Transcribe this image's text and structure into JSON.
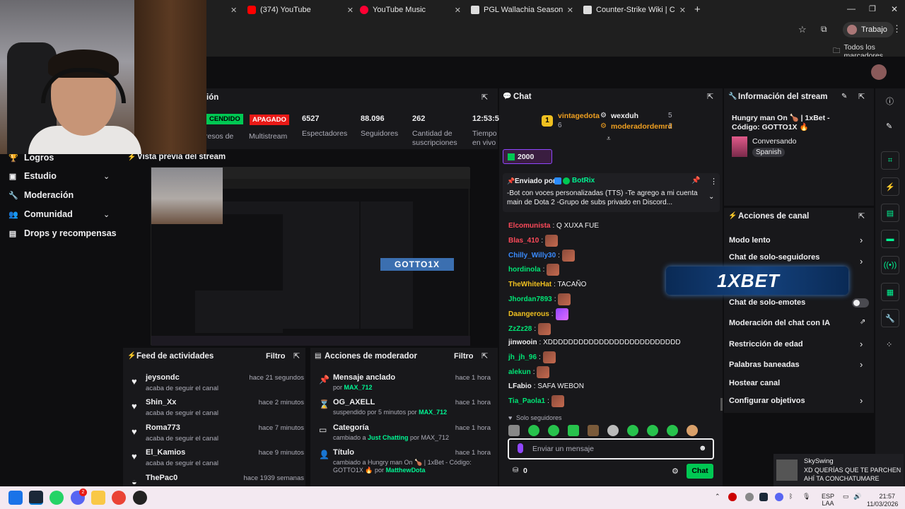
{
  "browser": {
    "tabs": [
      {
        "label": "(374) YouTube",
        "color": "#ff0000"
      },
      {
        "label": "YouTube Music",
        "color": "#ff0033"
      },
      {
        "label": "PGL Wallachia Season 7 - Liqui",
        "color": "#ffffff"
      },
      {
        "label": "Counter-Strike Wiki | CS2 | Liqu",
        "color": "#ffffff"
      }
    ],
    "profile_label": "Trabajo",
    "bookmarks_label": "Todos los marcadores"
  },
  "sidebar": {
    "items": [
      {
        "label": "Logros",
        "icon": "trophy-icon"
      },
      {
        "label": "Estudio",
        "icon": "studio-icon"
      },
      {
        "label": "Moderación",
        "icon": "wrench-icon"
      },
      {
        "label": "Comunidad",
        "icon": "community-icon"
      },
      {
        "label": "Drops y recompensas",
        "icon": "drops-icon"
      }
    ]
  },
  "session": {
    "title_fragment": "ión",
    "badge_on": "CENDIDO",
    "badge_off": "APAGADO",
    "stats": [
      {
        "value": "",
        "label": "resos de"
      },
      {
        "value": "",
        "label": "Multistream"
      },
      {
        "value": "6527",
        "label": "Espectadores"
      },
      {
        "value": "88.096",
        "label": "Seguidores"
      },
      {
        "value": "262",
        "label": "Cantidad de suscripciones"
      },
      {
        "value": "12:53:5",
        "label": "Tiempo en vivo"
      }
    ]
  },
  "preview": {
    "title": "Vista previa del stream",
    "overlay_text": "GOTTO1X"
  },
  "feed": {
    "title": "Feed de actividades",
    "filter_label": "Filtro",
    "items": [
      {
        "name": "jeysondc",
        "sub": "acaba de seguir el canal",
        "time": "hace 21 segundos"
      },
      {
        "name": "Shin_Xx",
        "sub": "acaba de seguir el canal",
        "time": "hace 2 minutos"
      },
      {
        "name": "Roma773",
        "sub": "acaba de seguir el canal",
        "time": "hace 7 minutos"
      },
      {
        "name": "El_Kamios",
        "sub": "acaba de seguir el canal",
        "time": "hace 9 minutos"
      },
      {
        "name": "ThePac0",
        "sub": "",
        "time": "hace 1939 semanas"
      }
    ]
  },
  "modactions": {
    "title": "Acciones de moderador",
    "filter_label": "Filtro",
    "items": [
      {
        "icon": "pin-icon",
        "name": "Mensaje anclado",
        "sub_pre": "por ",
        "sub_hl": "MAX_712",
        "sub_post": "",
        "time": "hace 1 hora"
      },
      {
        "icon": "hourglass-icon",
        "name": "OG_AXELL",
        "sub_pre": "suspendido por 5 minutos por ",
        "sub_hl": "MAX_712",
        "sub_post": "",
        "time": "hace 1 hora"
      },
      {
        "icon": "category-icon",
        "name": "Categoría",
        "sub_pre": "cambiado a ",
        "sub_hl": "Just Chatting",
        "sub_post": " por MAX_712",
        "time": "hace 1 hora"
      },
      {
        "icon": "title-icon",
        "name": "Título",
        "sub_pre": "cambiado a Hungry man On 🍗 | 1xBet - Código: GOTTO1X 🔥 por ",
        "sub_hl": "MatthewDota",
        "sub_post": "",
        "time": "hace 1 hora"
      }
    ]
  },
  "chat": {
    "title": "Chat",
    "leaderboard": [
      {
        "rank": "1",
        "name": "vintagedota",
        "count": "6",
        "color": "#f0a020"
      },
      {
        "rank": "",
        "name": "wexduh",
        "count": "5",
        "color": "#efeff1"
      },
      {
        "rank": "",
        "name": "moderadordemrd",
        "count": "1",
        "color": "#f0a020"
      }
    ],
    "bits_badge": "2000",
    "pinned": {
      "by_label": "Enviado por",
      "by_user": "BotRix",
      "text": "-Bot con voces personalizadas (TTS) -Te agrego a mi cuenta main de Dota 2 -Grupo de subs privado en Discord..."
    },
    "messages": [
      {
        "user": "Elcomunista",
        "color": "#ff4a5a",
        "text": ": Q XUXA FUE",
        "emote": false
      },
      {
        "user": "Blas_410",
        "color": "#ff4a5a",
        "text": ":",
        "emote": true
      },
      {
        "user": "Chilly_Willy30",
        "color": "#3a8cff",
        "text": ":",
        "emote": true
      },
      {
        "user": "hordinola",
        "color": "#00e676",
        "text": ":",
        "emote": true
      },
      {
        "user": "TheWhiteHat",
        "color": "#f0c020",
        "text": ": TACAÑO",
        "emote": false
      },
      {
        "user": "Jhordan7893",
        "color": "#00e676",
        "text": ":",
        "emote": true
      },
      {
        "user": "Daangerous",
        "color": "#f0c020",
        "text": ":",
        "emote": true
      },
      {
        "user": "ZzZz28",
        "color": "#00e676",
        "text": ":",
        "emote": true
      },
      {
        "user": "jinwooin",
        "color": "#efeff1",
        "text": ": XDDDDDDDDDDDDDDDDDDDDDDDDDD",
        "emote": false
      },
      {
        "user": "jh_jh_96",
        "color": "#00e676",
        "text": ":",
        "emote": true
      },
      {
        "user": "alekun",
        "color": "#00e676",
        "text": ":",
        "emote": true
      },
      {
        "user": "LFabio",
        "color": "#efeff1",
        "text": ": SAFA WEBON",
        "emote": false
      },
      {
        "user": "Tia_Paola1",
        "color": "#00e676",
        "text": ":",
        "emote": true
      }
    ],
    "followers_only": "Solo seguidores",
    "input_placeholder": "Enviar un mensaje",
    "points": "0",
    "send_label": "Chat"
  },
  "stream_info": {
    "title": "Información del stream",
    "stream_title": "Hungry man On 🍗 | 1xBet - Código: GOTTO1X 🔥",
    "category": "Conversando",
    "language": "Spanish"
  },
  "channel_actions": {
    "title": "Acciones de canal",
    "items": [
      {
        "label": "Modo lento",
        "chevron": true
      },
      {
        "label": "Chat de solo-seguidores",
        "chevron": true
      },
      {
        "label": "Chat de solo-emotes",
        "chevron": false
      },
      {
        "label": "Moderación del chat con IA",
        "chevron": false
      },
      {
        "label": "Restricción de edad",
        "chevron": true
      },
      {
        "label": "Palabras baneadas",
        "chevron": true
      },
      {
        "label": "Hostear canal",
        "chevron": false
      },
      {
        "label": "Configurar objetivos",
        "chevron": true
      }
    ],
    "ad_text": "1XBET"
  },
  "notification": {
    "user": "SkySwing",
    "text": "XD QUERÍAS QUE TE PARCHEN AHÍ TA CONCHATUMARE"
  },
  "taskbar": {
    "lang": "ESP",
    "region": "LAA",
    "time": "21:57",
    "date": "11/03/2026",
    "notif_count": "2"
  }
}
